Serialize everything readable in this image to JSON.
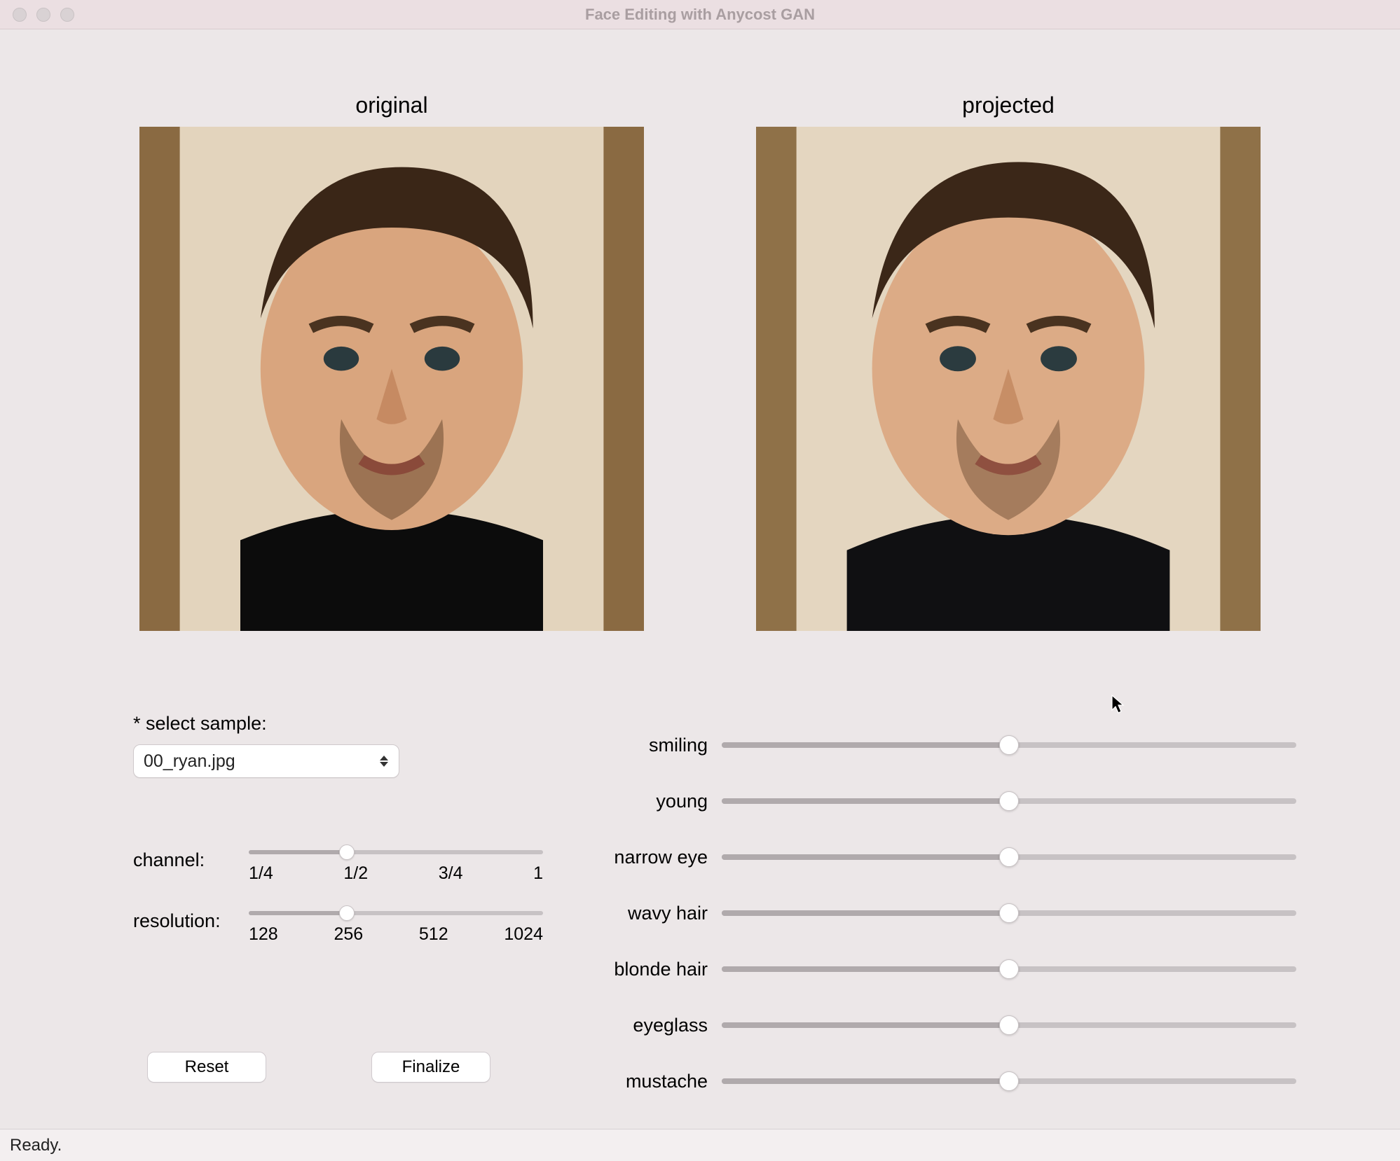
{
  "window": {
    "title": "Face Editing with Anycost GAN"
  },
  "images": {
    "original_label": "original",
    "projected_label": "projected"
  },
  "sample": {
    "label": "* select sample:",
    "selected": "00_ryan.jpg"
  },
  "channel": {
    "label": "channel:",
    "ticks": [
      "1/4",
      "1/2",
      "3/4",
      "1"
    ],
    "value_index": 1
  },
  "resolution": {
    "label": "resolution:",
    "ticks": [
      "128",
      "256",
      "512",
      "1024"
    ],
    "value_index": 1
  },
  "buttons": {
    "reset": "Reset",
    "finalize": "Finalize"
  },
  "attributes": [
    {
      "label": "smiling",
      "value": 0.5
    },
    {
      "label": "young",
      "value": 0.5
    },
    {
      "label": "narrow eye",
      "value": 0.5
    },
    {
      "label": "wavy hair",
      "value": 0.5
    },
    {
      "label": "blonde hair",
      "value": 0.5
    },
    {
      "label": "eyeglass",
      "value": 0.5
    },
    {
      "label": "mustache",
      "value": 0.5
    }
  ],
  "status": "Ready."
}
